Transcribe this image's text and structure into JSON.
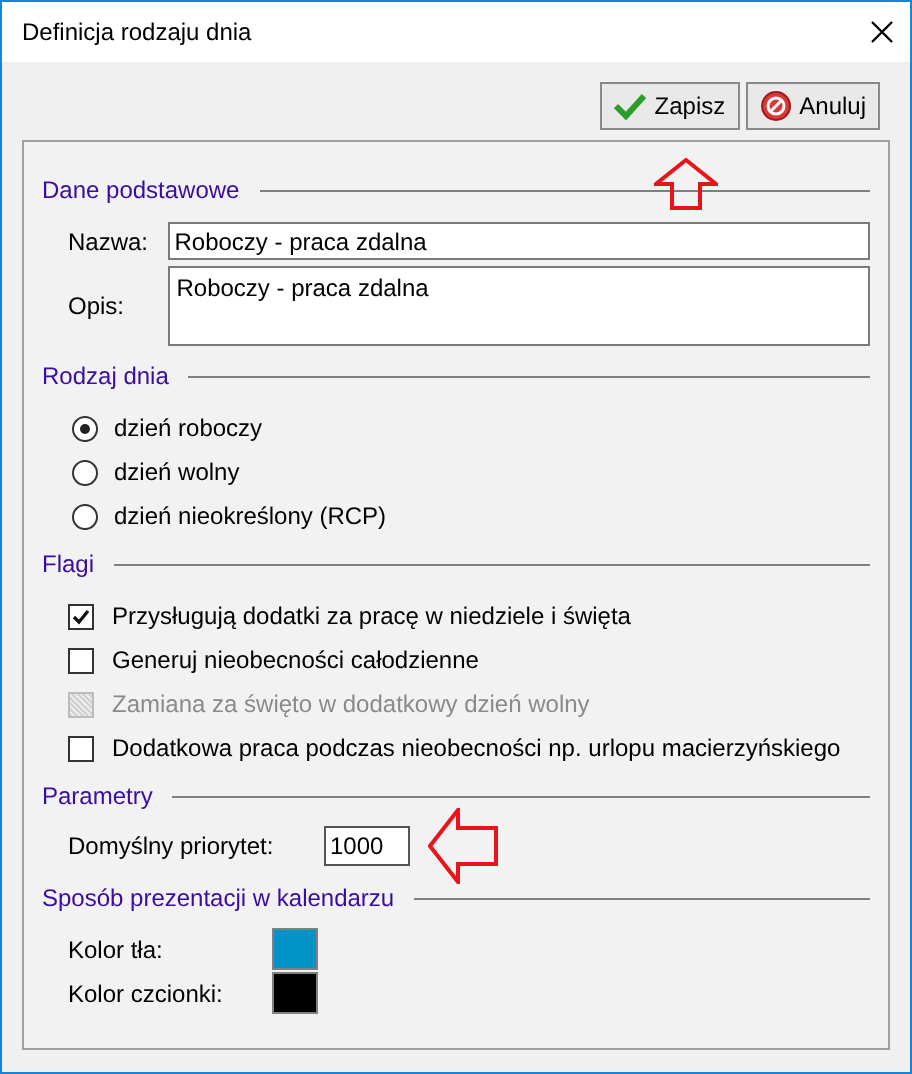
{
  "window": {
    "title": "Definicja rodzaju dnia"
  },
  "buttons": [
    {
      "kind": "save",
      "label": "Zapisz"
    },
    {
      "kind": "cancel",
      "label": "Anuluj"
    }
  ],
  "basic": {
    "heading": "Dane podstawowe",
    "name_label": "Nazwa:",
    "name_value": "Roboczy - praca zdalna",
    "desc_label": "Opis:",
    "desc_value": "Roboczy - praca zdalna"
  },
  "day_type": {
    "heading": "Rodzaj dnia",
    "options": [
      {
        "label": "dzień roboczy",
        "selected": true
      },
      {
        "label": "dzień wolny",
        "selected": false
      },
      {
        "label": "dzień nieokreślony (RCP)",
        "selected": false
      }
    ]
  },
  "flags": {
    "heading": "Flagi",
    "items": [
      {
        "label": "Przysługują dodatki za pracę w niedziele i święta",
        "checked": true,
        "disabled": false
      },
      {
        "label": "Generuj nieobecności całodzienne",
        "checked": false,
        "disabled": false
      },
      {
        "label": "Zamiana za święto w dodatkowy dzień wolny",
        "checked": false,
        "disabled": true
      },
      {
        "label": "Dodatkowa praca podczas nieobecności np. urlopu macierzyńskiego",
        "checked": false,
        "disabled": false
      }
    ]
  },
  "parameters": {
    "heading": "Parametry",
    "priority_label": "Domyślny priorytet:",
    "priority_value": "1000"
  },
  "calendar": {
    "heading": "Sposób prezentacji w kalendarzu",
    "colors": [
      {
        "label": "Kolor tła:",
        "color": "#0093c8"
      },
      {
        "label": "Kolor czcionki:",
        "color": "#000000"
      }
    ]
  }
}
